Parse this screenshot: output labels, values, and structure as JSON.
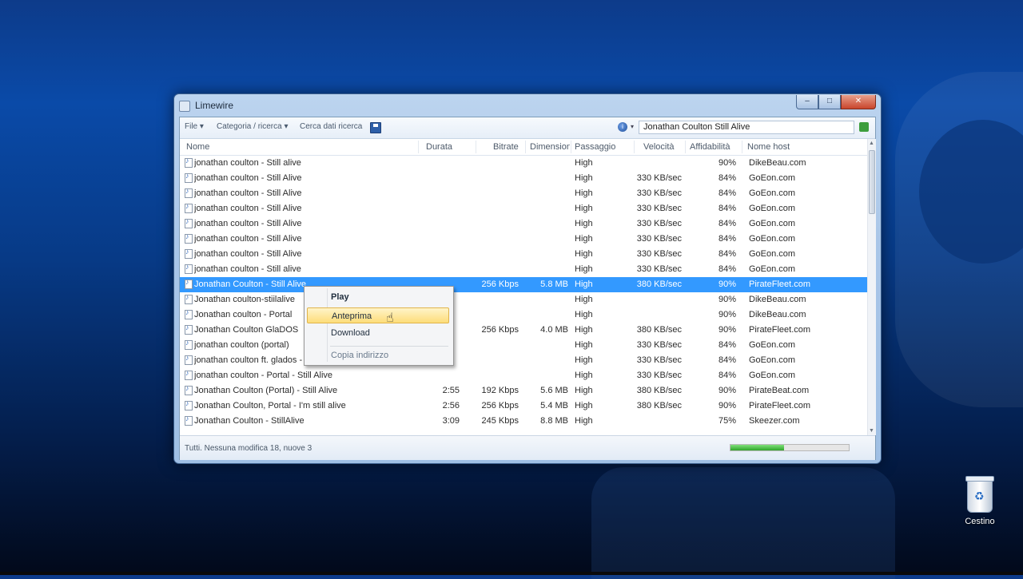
{
  "desktop": {
    "recycle_bin_label": "Cestino"
  },
  "window": {
    "title": "Limewire",
    "buttons": {
      "minimize": "–",
      "maximize": "□",
      "close": "✕"
    }
  },
  "toolbar": {
    "items": [
      "File ▾",
      "Categoria / ricerca ▾",
      "Cerca dati ricerca"
    ],
    "search_value": "Jonathan Coulton Still Alive"
  },
  "table": {
    "columns": [
      "Nome",
      "Durata",
      "Bitrate",
      "Dimensione",
      "Passaggio",
      "Velocità",
      "Affidabilità",
      "Nome host"
    ],
    "rows": [
      {
        "name": "jonathan coulton - Still alive",
        "dur": "",
        "bit": "",
        "size": "",
        "pass": "High",
        "speed": "",
        "rel": "90%",
        "host": "DikeBeau.com"
      },
      {
        "name": "jonathan coulton - Still Alive",
        "dur": "",
        "bit": "",
        "size": "",
        "pass": "High",
        "speed": "330 KB/sec",
        "rel": "84%",
        "host": "GoEon.com"
      },
      {
        "name": "jonathan coulton - Still Alive",
        "dur": "",
        "bit": "",
        "size": "",
        "pass": "High",
        "speed": "330 KB/sec",
        "rel": "84%",
        "host": "GoEon.com"
      },
      {
        "name": "jonathan coulton - Still Alive",
        "dur": "",
        "bit": "",
        "size": "",
        "pass": "High",
        "speed": "330 KB/sec",
        "rel": "84%",
        "host": "GoEon.com"
      },
      {
        "name": "jonathan coulton - Still Alive",
        "dur": "",
        "bit": "",
        "size": "",
        "pass": "High",
        "speed": "330 KB/sec",
        "rel": "84%",
        "host": "GoEon.com"
      },
      {
        "name": "jonathan coulton - Still Alive",
        "dur": "",
        "bit": "",
        "size": "",
        "pass": "High",
        "speed": "330 KB/sec",
        "rel": "84%",
        "host": "GoEon.com"
      },
      {
        "name": "jonathan coulton - Still Alive",
        "dur": "",
        "bit": "",
        "size": "",
        "pass": "High",
        "speed": "330 KB/sec",
        "rel": "84%",
        "host": "GoEon.com"
      },
      {
        "name": "jonathan coulton - Still alive",
        "dur": "",
        "bit": "",
        "size": "",
        "pass": "High",
        "speed": "330 KB/sec",
        "rel": "84%",
        "host": "GoEon.com"
      },
      {
        "name": "Jonathan Coulton - Still Alive",
        "dur": "",
        "bit": "256 Kbps",
        "size": "5.8 MB",
        "pass": "High",
        "speed": "380 KB/sec",
        "rel": "90%",
        "host": "PirateFleet.com"
      },
      {
        "name": "Jonathan coulton-stiilalive",
        "dur": "",
        "bit": "",
        "size": "",
        "pass": "High",
        "speed": "",
        "rel": "90%",
        "host": "DikeBeau.com"
      },
      {
        "name": "Jonathan coulton - Portal",
        "dur": "",
        "bit": "",
        "size": "",
        "pass": "High",
        "speed": "",
        "rel": "90%",
        "host": "DikeBeau.com"
      },
      {
        "name": "Jonathan Coulton GlaDOS",
        "dur": "",
        "bit": "256 Kbps",
        "size": "4.0 MB",
        "pass": "High",
        "speed": "380 KB/sec",
        "rel": "90%",
        "host": "PirateFleet.com"
      },
      {
        "name": "jonathan coulton (portal)",
        "dur": "",
        "bit": "",
        "size": "",
        "pass": "High",
        "speed": "330 KB/sec",
        "rel": "84%",
        "host": "GoEon.com"
      },
      {
        "name": "jonathan coulton ft. glados - Still Alive",
        "dur": "",
        "bit": "",
        "size": "",
        "pass": "High",
        "speed": "330 KB/sec",
        "rel": "84%",
        "host": "GoEon.com"
      },
      {
        "name": "jonathan coulton - Portal - Still Alive",
        "dur": "",
        "bit": "",
        "size": "",
        "pass": "High",
        "speed": "330 KB/sec",
        "rel": "84%",
        "host": "GoEon.com"
      },
      {
        "name": "Jonathan Coulton (Portal) - Still Alive",
        "dur": "2:55",
        "bit": "192 Kbps",
        "size": "5.6 MB",
        "pass": "High",
        "speed": "380 KB/sec",
        "rel": "90%",
        "host": "PirateBeat.com"
      },
      {
        "name": "Jonathan Coulton, Portal - I'm still alive",
        "dur": "2:56",
        "bit": "256 Kbps",
        "size": "5.4 MB",
        "pass": "High",
        "speed": "380 KB/sec",
        "rel": "90%",
        "host": "PirateFleet.com"
      },
      {
        "name": "Jonathan Coulton - StillAlive",
        "dur": "3:09",
        "bit": "245 Kbps",
        "size": "8.8 MB",
        "pass": "High",
        "speed": "",
        "rel": "75%",
        "host": "Skeezer.com"
      }
    ],
    "selected_row": 8
  },
  "context_menu": {
    "items": [
      "Play",
      "Anteprima",
      "Download",
      "Copia indirizzo"
    ],
    "hover_index": 1
  },
  "status": {
    "text": "Tutti. Nessuna modifica 18, nuove 3",
    "progress": 0.45
  },
  "colors": {
    "selection": "#3399ff",
    "menu_hover": "#fddd7a"
  }
}
